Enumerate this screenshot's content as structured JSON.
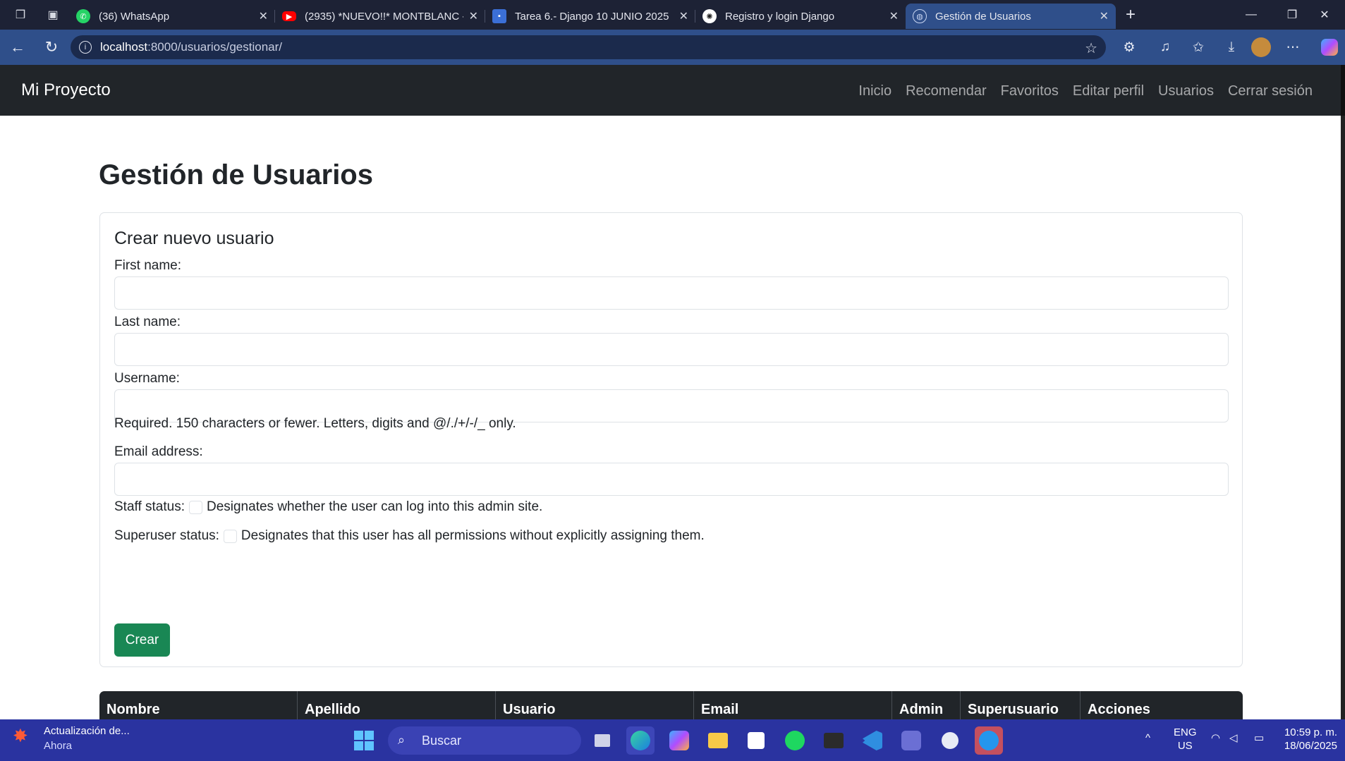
{
  "browser": {
    "tabs": [
      {
        "title": "(36) WhatsApp",
        "icon": "whatsapp-icon",
        "color": "#25d366",
        "active": false
      },
      {
        "title": "(2935) *NUEVO!!* MONTBLANC -",
        "icon": "youtube-icon",
        "color": "#ff0000",
        "active": false
      },
      {
        "title": "Tarea 6.- Django 10 JUNIO 2025",
        "icon": "classroom-icon",
        "color": "#3b6fd6",
        "active": false
      },
      {
        "title": "Registro y login Django",
        "icon": "openai-icon",
        "color": "#ffffff",
        "active": false
      },
      {
        "title": "Gestión de Usuarios",
        "icon": "globe-icon",
        "color": "#8fa8d8",
        "active": true
      }
    ],
    "url_host": "localhost",
    "url_path": ":8000/usuarios/gestionar/"
  },
  "site": {
    "brand": "Mi Proyecto",
    "nav": [
      "Inicio",
      "Recomendar",
      "Favoritos",
      "Editar perfil",
      "Usuarios",
      "Cerrar sesión"
    ]
  },
  "page": {
    "title": "Gestión de Usuarios",
    "form": {
      "heading": "Crear nuevo usuario",
      "first_name_label": "First name:",
      "last_name_label": "Last name:",
      "username_label": "Username:",
      "username_help": "Required. 150 characters or fewer. Letters, digits and @/./+/-/_ only.",
      "email_label": "Email address:",
      "staff_label": "Staff status:",
      "staff_help": "Designates whether the user can log into this admin site.",
      "superuser_label": "Superuser status:",
      "superuser_help": "Designates that this user has all permissions without explicitly assigning them.",
      "submit_label": "Crear",
      "staff_checked": false,
      "superuser_checked": false
    },
    "table": {
      "headers": [
        "Nombre",
        "Apellido",
        "Usuario",
        "Email",
        "Admin",
        "Superusuario",
        "Acciones"
      ]
    }
  },
  "taskbar": {
    "notification_title": "Actualización de...",
    "notification_sub": "Ahora",
    "search_placeholder": "Buscar",
    "lang_top": "ENG",
    "lang_bottom": "US",
    "time": "10:59 p. m.",
    "date": "18/06/2025"
  }
}
